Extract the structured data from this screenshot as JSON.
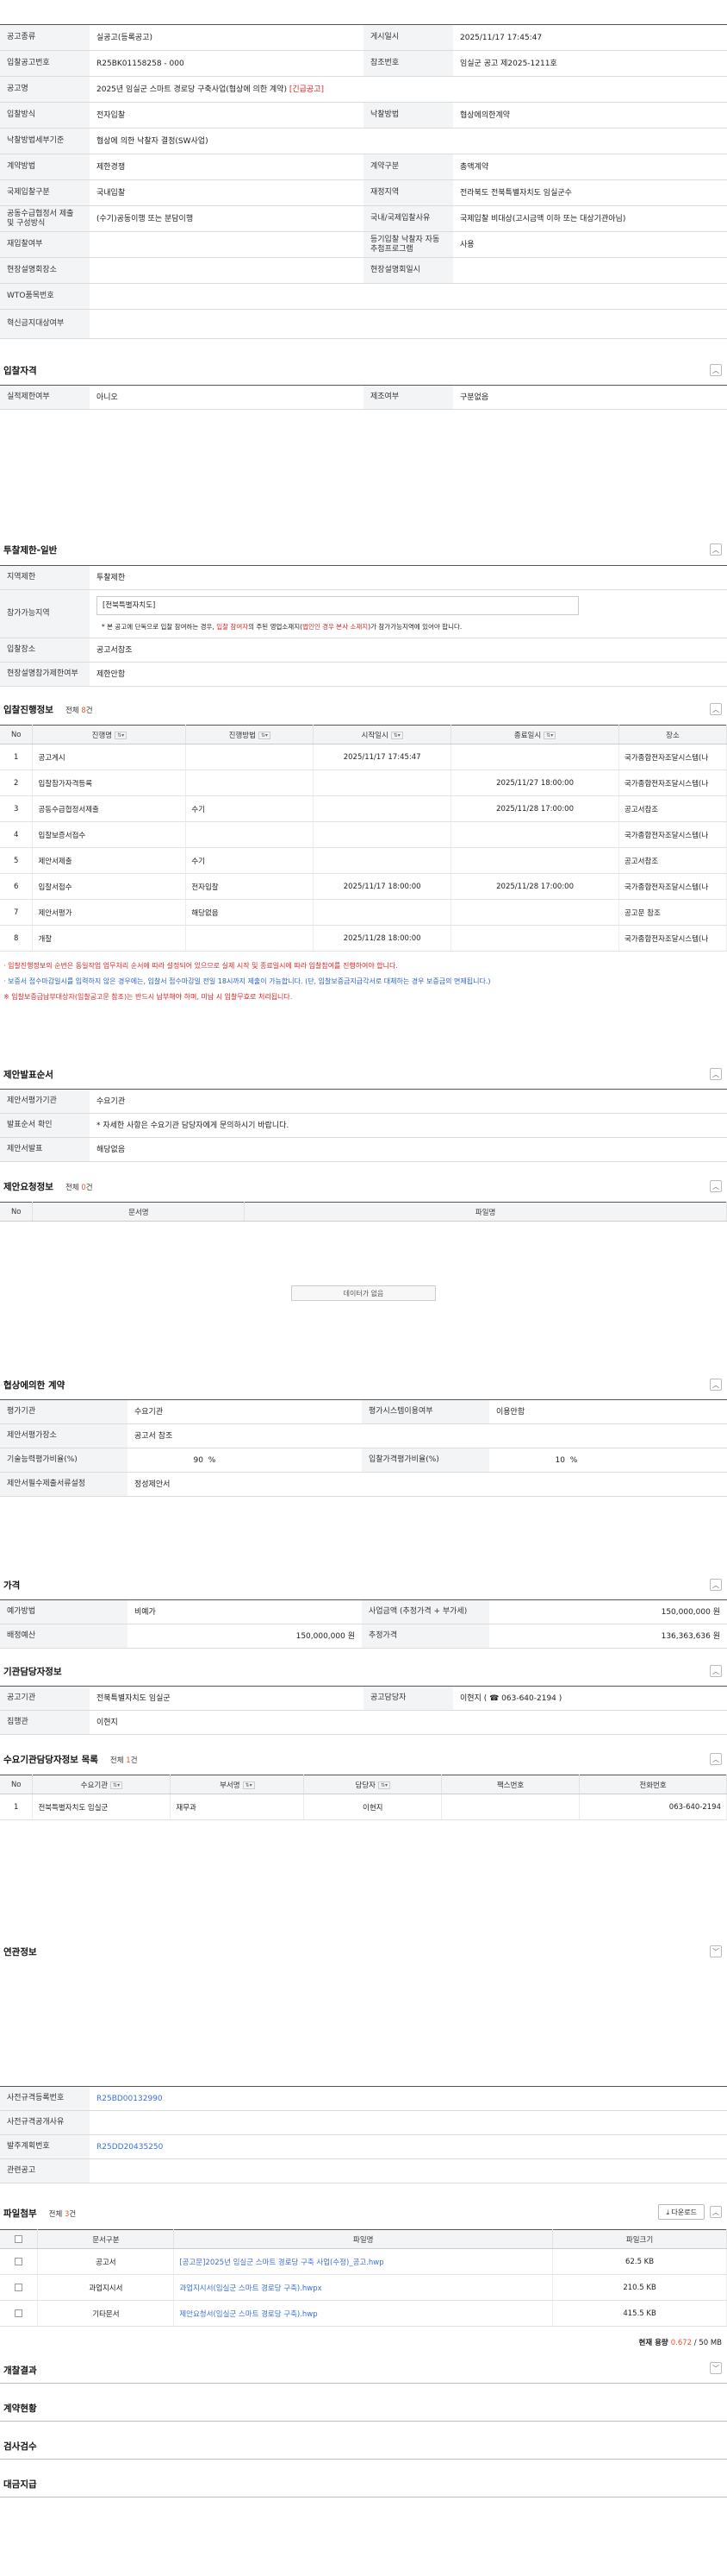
{
  "basic": {
    "notice_type_label": "공고종류",
    "notice_type": "실공고(등록공고)",
    "post_date_label": "게시일시",
    "post_date": "2025/11/17 17:45:47",
    "bid_no_label": "입찰공고번호",
    "bid_no": "R25BK01158258 - 000",
    "ref_no_label": "참조번호",
    "ref_no": "임실군 공고 제2025-1211호",
    "name_label": "공고명",
    "name": "2025년 임실군 스마트 경로당 구축사업(협상에 의한 계약)",
    "name_tag": "[긴급공고]",
    "bid_method_label": "입찰방식",
    "bid_method": "전자입찰",
    "award_method_label": "낙찰방법",
    "award_method": "협상에의한계약",
    "award_detail_label": "낙찰방법세부기준",
    "award_detail": "협상에 의한 낙찰자 결정(SW사업)",
    "contract_method_label": "계약방법",
    "contract_method": "제한경쟁",
    "contract_type_label": "계약구분",
    "contract_type": "총액계약",
    "intl_label": "국제입찰구분",
    "intl": "국내입찰",
    "finance_label": "재정지역",
    "finance": "전라북도 전북특별자치도 임실군수",
    "joint_label": "공동수급협정서 제출 및 구성방식",
    "joint": "(수기)공동이행 또는 분담이행",
    "intl_reason_label": "국내/국제입찰사유",
    "intl_reason": "국제입찰 비대상(고시금액 이하 또는 대상기관아님)",
    "rebid_label": "재입찰여부",
    "rebid": "",
    "ebid_label": "등기입찰 낙찰자 자동추첨프로그램",
    "ebid": "사용",
    "site_label": "현장설명회장소",
    "site": "",
    "site_date_label": "현장설명회일시",
    "site_date": "",
    "wto_label": "WTO품목번호",
    "wto": "",
    "special_label": "혁신금지대상여부",
    "special": ""
  },
  "qualification": {
    "title": "입찰자격",
    "perf_label": "실적제한여부",
    "perf": "아니오",
    "mfr_label": "제조여부",
    "mfr": "구분없음"
  },
  "restriction": {
    "title": "투찰제한-일반",
    "region_label": "지역제한",
    "region": "투찰제한",
    "allowed_label": "참가가능지역",
    "allowed": "[전북특별자치도]",
    "note_pre": "* 본 공고에 단독으로 입찰 참여하는 경우, ",
    "note_red1": "입찰 참여자",
    "note_mid": "의 주된 영업소재지(",
    "note_red2": "법인인 경우 본사 소재지",
    "note_post": ")가 참가가능지역에 있어야 합니다.",
    "place_label": "입찰장소",
    "place": "공고서참조",
    "brief_label": "현장설명참가제한여부",
    "brief": "제한안함"
  },
  "progress": {
    "title": "입찰진행정보",
    "count_pre": "전체 ",
    "count": "8",
    "count_post": "건",
    "headers": [
      "No",
      "진행명",
      "진행방법",
      "시작일시",
      "종료일시",
      "장소"
    ],
    "rows": [
      [
        "1",
        "공고게시",
        "",
        "2025/11/17 17:45:47",
        "",
        "국가종합전자조달시스템(나"
      ],
      [
        "2",
        "입찰참가자격등록",
        "",
        "",
        "2025/11/27 18:00:00",
        "국가종합전자조달시스템(나"
      ],
      [
        "3",
        "공동수급협정서제출",
        "수기",
        "",
        "2025/11/28 17:00:00",
        "공고서참조"
      ],
      [
        "4",
        "입찰보증서접수",
        "",
        "",
        "",
        "국가종합전자조달시스템(나"
      ],
      [
        "5",
        "제안서제출",
        "수기",
        "",
        "",
        "공고서참조"
      ],
      [
        "6",
        "입찰서접수",
        "전자입찰",
        "2025/11/17 18:00:00",
        "2025/11/28 17:00:00",
        "국가종합전자조달시스템(나"
      ],
      [
        "7",
        "제안서평가",
        "해당없음",
        "",
        "",
        "공고문 참조"
      ],
      [
        "8",
        "개찰",
        "",
        "2025/11/28 18:00:00",
        "",
        "국가종합전자조달시스템(나"
      ]
    ],
    "note1": "· 입찰진행정보의 순번은 동일작업 업무처리 순서에 따라 설정되어 있으므로 실제 시작 및 종료일시에 따라 입찰참여를 진행하여야 합니다.",
    "note2": "· 보증서 접수마감일시를 입력하지 않은 경우에는, 입찰서 접수마감일 전일 18시까지 제출이 가능합니다. (단, 입찰보증금지급각서로 대체하는 경우 보증금의 면제됩니다.)",
    "note3": "※ 입찰보증금납부대상자(입찰공고문 참조)는 반드시 납부해야 하며, 미납 시 입찰무효로 처리됩니다."
  },
  "proposal_order": {
    "title": "제안발표순서",
    "agency_label": "제안서평가기관",
    "agency": "수요기관",
    "confirm_label": "발표순서 확인",
    "confirm": "* 자세한 사항은 수요기관 담당자에게 문의하시기 바랍니다.",
    "present_label": "제안서발표",
    "present": "해당없음"
  },
  "proposal_req": {
    "title": "제안요청정보",
    "count_pre": "전체 ",
    "count": "0",
    "count_post": "건",
    "headers": [
      "No",
      "문서명",
      "파일명"
    ],
    "empty": "데이터가 없음"
  },
  "nego": {
    "title": "협상에의한 계약",
    "eval_label": "평가기관",
    "eval": "수요기관",
    "sys_label": "평가시스템이용여부",
    "sys": "이용안함",
    "place_label": "제안서평가장소",
    "place": "공고서 참조",
    "tech_label": "기술능력평가비율(%)",
    "tech": "90",
    "tech_unit": "%",
    "price_label": "입찰가격평가비율(%)",
    "price": "10",
    "price_unit": "%",
    "doc_label": "제안서필수제출서류설정",
    "doc": "정성제안서"
  },
  "pricing": {
    "title": "가격",
    "method_label": "예가방법",
    "method": "비예가",
    "amount_label": "사업금액 (추정가격 + 부가세)",
    "amount": "150,000,000 원",
    "budget_label": "배정예산",
    "budget": "150,000,000 원",
    "est_label": "추정가격",
    "est": "136,363,636 원"
  },
  "agency": {
    "title": "기관담당자정보",
    "org_label": "공고기관",
    "org": "전북특별자치도 임실군",
    "person_label": "공고담당자",
    "person": "이현지 ( ☎ 063-640-2194 )",
    "exec_label": "집행관",
    "exec": "이현지"
  },
  "demand": {
    "title": "수요기관담당자정보 목록",
    "count_pre": "전체 ",
    "count": "1",
    "count_post": "건",
    "headers": [
      "No",
      "수요기관",
      "부서명",
      "담당자",
      "팩스번호",
      "전화번호"
    ],
    "rows": [
      [
        "1",
        "전북특별자치도 임실군",
        "재무과",
        "이현지",
        "",
        "063-640-2194"
      ]
    ]
  },
  "related": {
    "title": "연관정보",
    "pre_label": "사전규격등록번호",
    "pre": "R25BD00132990",
    "pre_pub_label": "사전규격공개사유",
    "pre_pub": "",
    "order_label": "발주계획번호",
    "order": "R25DD20435250",
    "rel_label": "관련공고",
    "rel": ""
  },
  "files": {
    "title": "파일첨부",
    "count_pre": "전체 ",
    "count": "3",
    "count_post": "건",
    "download": "⤓ 다운로드",
    "headers": [
      "문서구분",
      "파일명",
      "파일크기"
    ],
    "rows": [
      [
        "공고서",
        "[공고문]2025년 임실군 스마트 경로당 구축 사업(수정)_공고.hwp",
        "62.5 KB"
      ],
      [
        "과업지시서",
        "과업지시서(임실군 스마트 경로당 구축).hwpx",
        "210.5 KB"
      ],
      [
        "기타문서",
        "제안요청서(임실군 스마트 경로당 구축).hwp",
        "415.5 KB"
      ]
    ],
    "capacity_pre": "현재 용량 ",
    "capacity": "0.672",
    "capacity_post": " / 50 MB"
  },
  "folds": {
    "result": "개찰결과",
    "contract": "계약현황",
    "inspection": "검사검수",
    "payment": "대금지급"
  },
  "icons": {
    "collapse": "chevron-up-icon",
    "expand": "chevron-down-icon"
  },
  "colors": {
    "accent": "#e8542f",
    "link": "#3b6fd6",
    "red": "#e02424"
  }
}
